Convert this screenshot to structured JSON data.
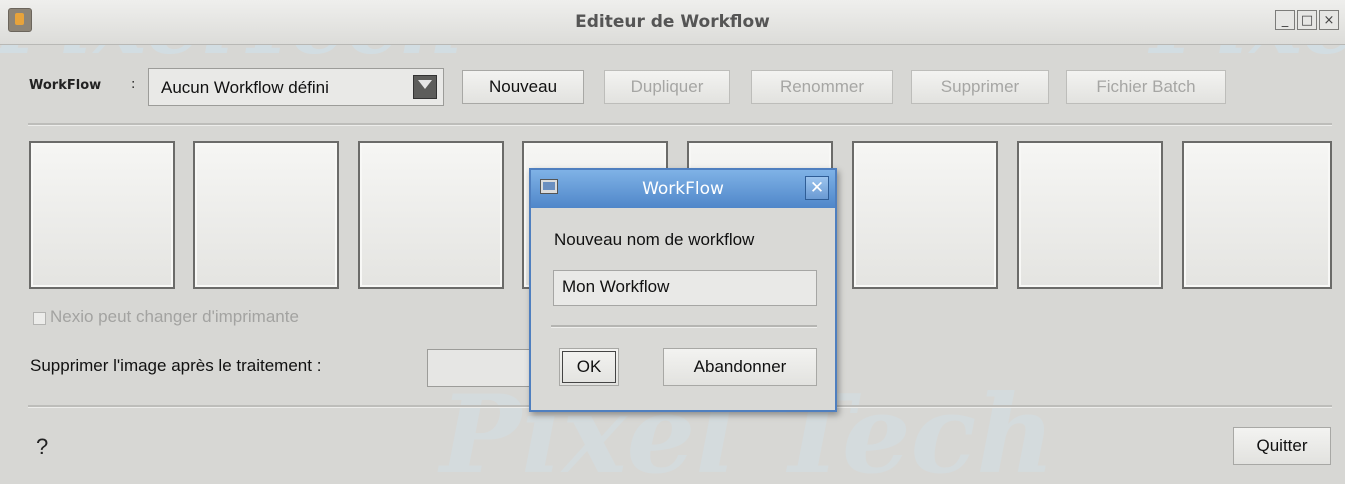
{
  "window": {
    "title": "Editeur de Workflow",
    "controls": {
      "minimize": "_",
      "maximize": "□",
      "close": "×"
    }
  },
  "toolbar": {
    "workflow_label": "WorkFlow",
    "separator": ":",
    "workflow_select_value": "Aucun Workflow défini",
    "buttons": {
      "new": "Nouveau",
      "duplicate": "Dupliquer",
      "rename": "Renommer",
      "delete": "Supprimer",
      "batch_file": "Fichier Batch"
    }
  },
  "options": {
    "nexio_checkbox_label": "Nexio peut changer d'imprimante",
    "nexio_checked": false,
    "delete_image_label": "Supprimer l'image après le traitement  :"
  },
  "footer": {
    "help": "?",
    "quit": "Quitter"
  },
  "dialog": {
    "title": "WorkFlow",
    "close": "✕",
    "prompt": "Nouveau nom de workflow",
    "input_value": "Mon Workflow",
    "ok": "OK",
    "cancel": "Abandonner"
  },
  "watermark": {
    "text_top_left": "PixelTech",
    "text_top_right": "Pixel",
    "text_bottom": "Pixel Tech"
  }
}
